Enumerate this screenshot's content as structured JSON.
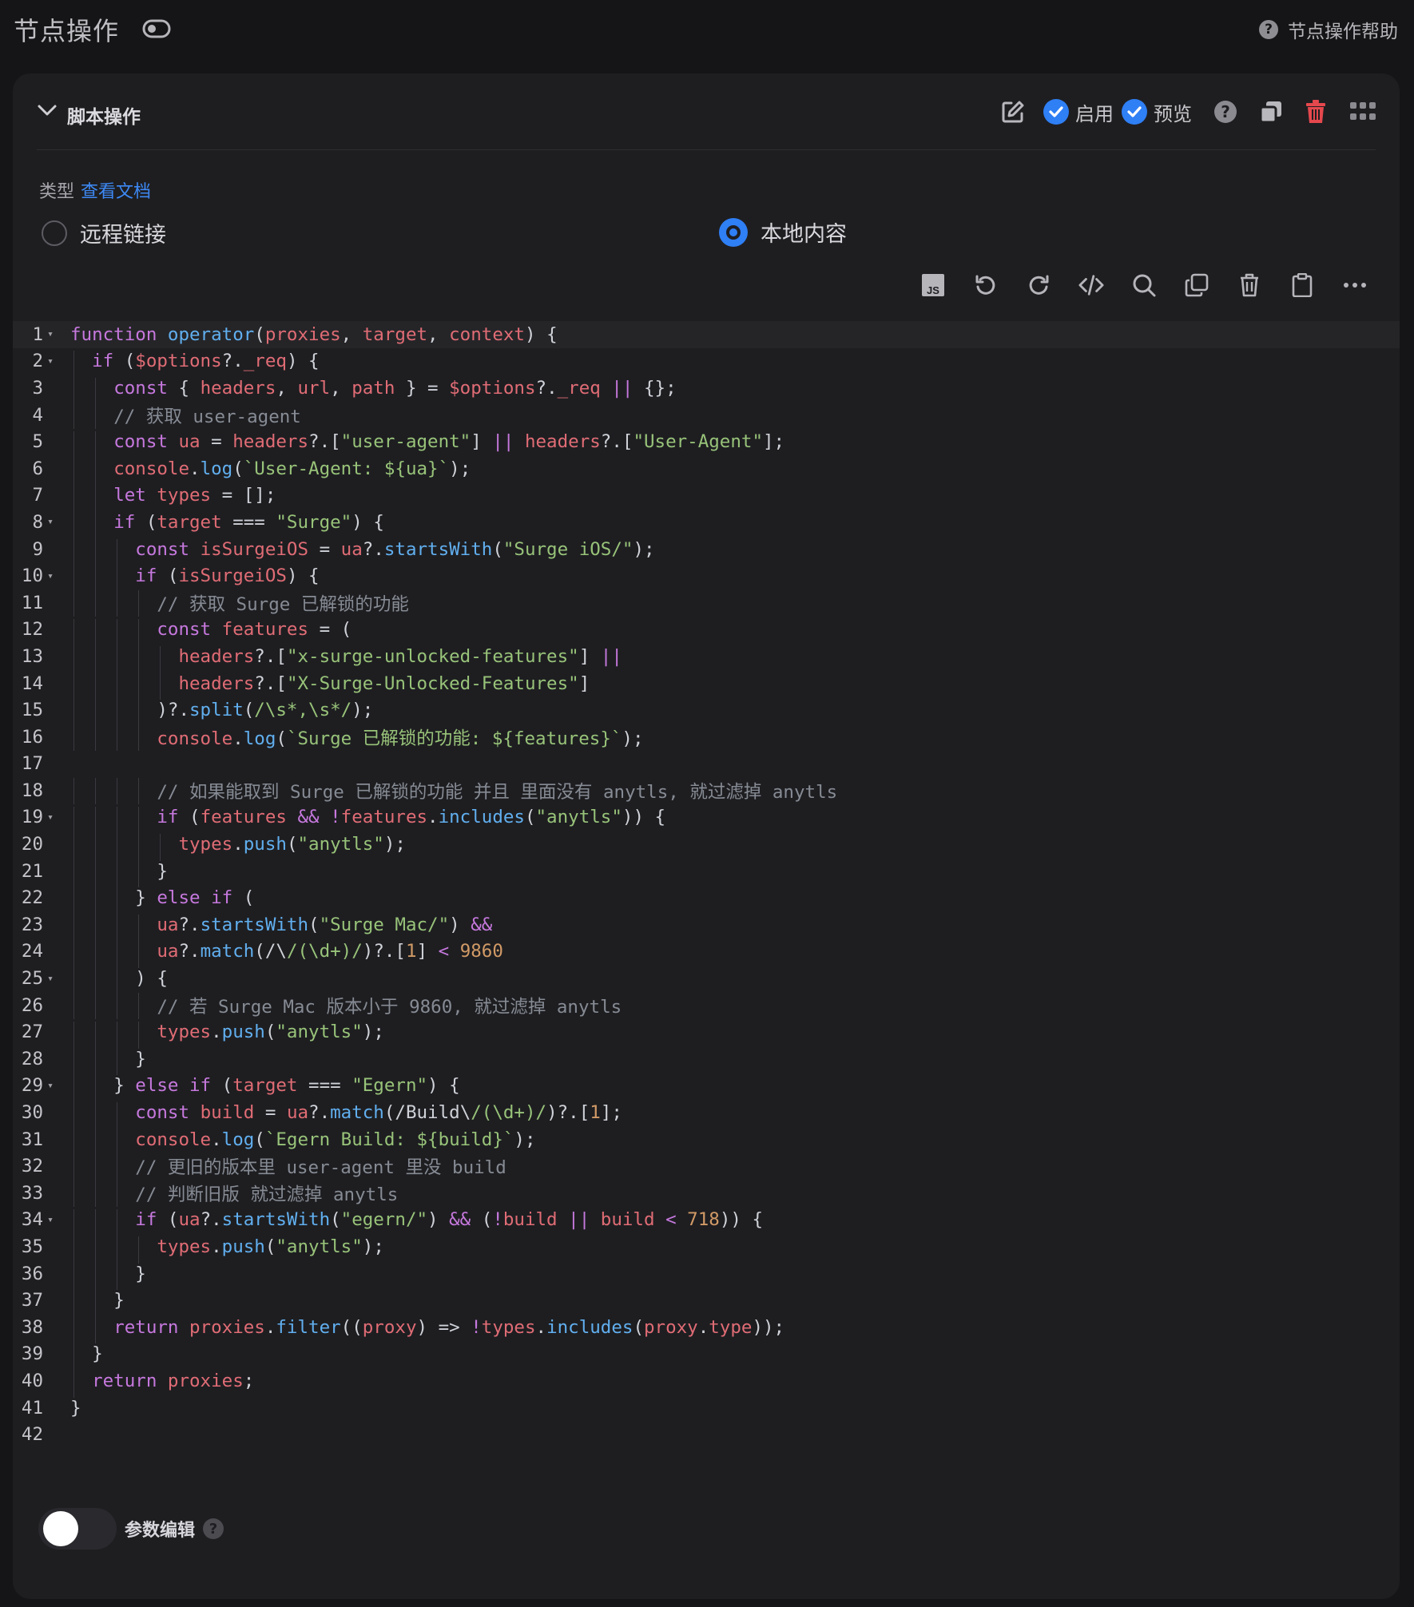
{
  "header": {
    "title": "节点操作",
    "help_label": "节点操作帮助",
    "help_icon": "?"
  },
  "section": {
    "title": "脚本操作",
    "enable_label": "启用",
    "preview_label": "预览",
    "help_icon": "?"
  },
  "type_row": {
    "label": "类型",
    "doc_link": "查看文档"
  },
  "radios": [
    {
      "label": "远程链接",
      "selected": false
    },
    {
      "label": "本地内容",
      "selected": true
    }
  ],
  "toolbar": {
    "js_badge": "JS"
  },
  "params": {
    "label": "参数编辑",
    "help_icon": "?",
    "enabled": false
  },
  "colors": {
    "accent": "#2f7ff5",
    "danger": "#e5484d",
    "background": "#151517",
    "card": "#1e1e21"
  },
  "code_lines": [
    [
      1,
      "function operator(proxies, target, context) {"
    ],
    [
      2,
      "  if ($options?._req) {"
    ],
    [
      3,
      "    const { headers, url, path } = $options?._req || {};"
    ],
    [
      4,
      "    // 获取 user-agent"
    ],
    [
      5,
      "    const ua = headers?.[\"user-agent\"] || headers?.[\"User-Agent\"];"
    ],
    [
      6,
      "    console.log(`User-Agent: ${ua}`);"
    ],
    [
      7,
      "    let types = [];"
    ],
    [
      8,
      "    if (target === \"Surge\") {"
    ],
    [
      9,
      "      const isSurgeiOS = ua?.startsWith(\"Surge iOS/\");"
    ],
    [
      10,
      "      if (isSurgeiOS) {"
    ],
    [
      11,
      "        // 获取 Surge 已解锁的功能"
    ],
    [
      12,
      "        const features = ("
    ],
    [
      13,
      "          headers?.[\"x-surge-unlocked-features\"] ||"
    ],
    [
      14,
      "          headers?.[\"X-Surge-Unlocked-Features\"]"
    ],
    [
      15,
      "        )?.split(/\\s*,\\s*/);"
    ],
    [
      16,
      "        console.log(`Surge 已解锁的功能: ${features}`);"
    ],
    [
      17,
      ""
    ],
    [
      18,
      "        // 如果能取到 Surge 已解锁的功能 并且 里面没有 anytls, 就过滤掉 anytls"
    ],
    [
      19,
      "        if (features && !features.includes(\"anytls\")) {"
    ],
    [
      20,
      "          types.push(\"anytls\");"
    ],
    [
      21,
      "        }"
    ],
    [
      22,
      "      } else if ("
    ],
    [
      23,
      "        ua?.startsWith(\"Surge Mac/\") &&"
    ],
    [
      24,
      "        ua?.match(/\\/(\\d+)/)?.[1] < 9860"
    ],
    [
      25,
      "      ) {"
    ],
    [
      26,
      "        // 若 Surge Mac 版本小于 9860, 就过滤掉 anytls"
    ],
    [
      27,
      "        types.push(\"anytls\");"
    ],
    [
      28,
      "      }"
    ],
    [
      29,
      "    } else if (target === \"Egern\") {"
    ],
    [
      30,
      "      const build = ua?.match(/Build\\/(\\d+)/)?.[1];"
    ],
    [
      31,
      "      console.log(`Egern Build: ${build}`);"
    ],
    [
      32,
      "      // 更旧的版本里 user-agent 里没 build"
    ],
    [
      33,
      "      // 判断旧版 就过滤掉 anytls"
    ],
    [
      34,
      "      if (ua?.startsWith(\"egern/\") && (!build || build < 718)) {"
    ],
    [
      35,
      "        types.push(\"anytls\");"
    ],
    [
      36,
      "      }"
    ],
    [
      37,
      "    }"
    ],
    [
      38,
      "    return proxies.filter((proxy) => !types.includes(proxy.type));"
    ],
    [
      39,
      "  }"
    ],
    [
      40,
      "  return proxies;"
    ],
    [
      41,
      "}"
    ],
    [
      42,
      ""
    ]
  ]
}
